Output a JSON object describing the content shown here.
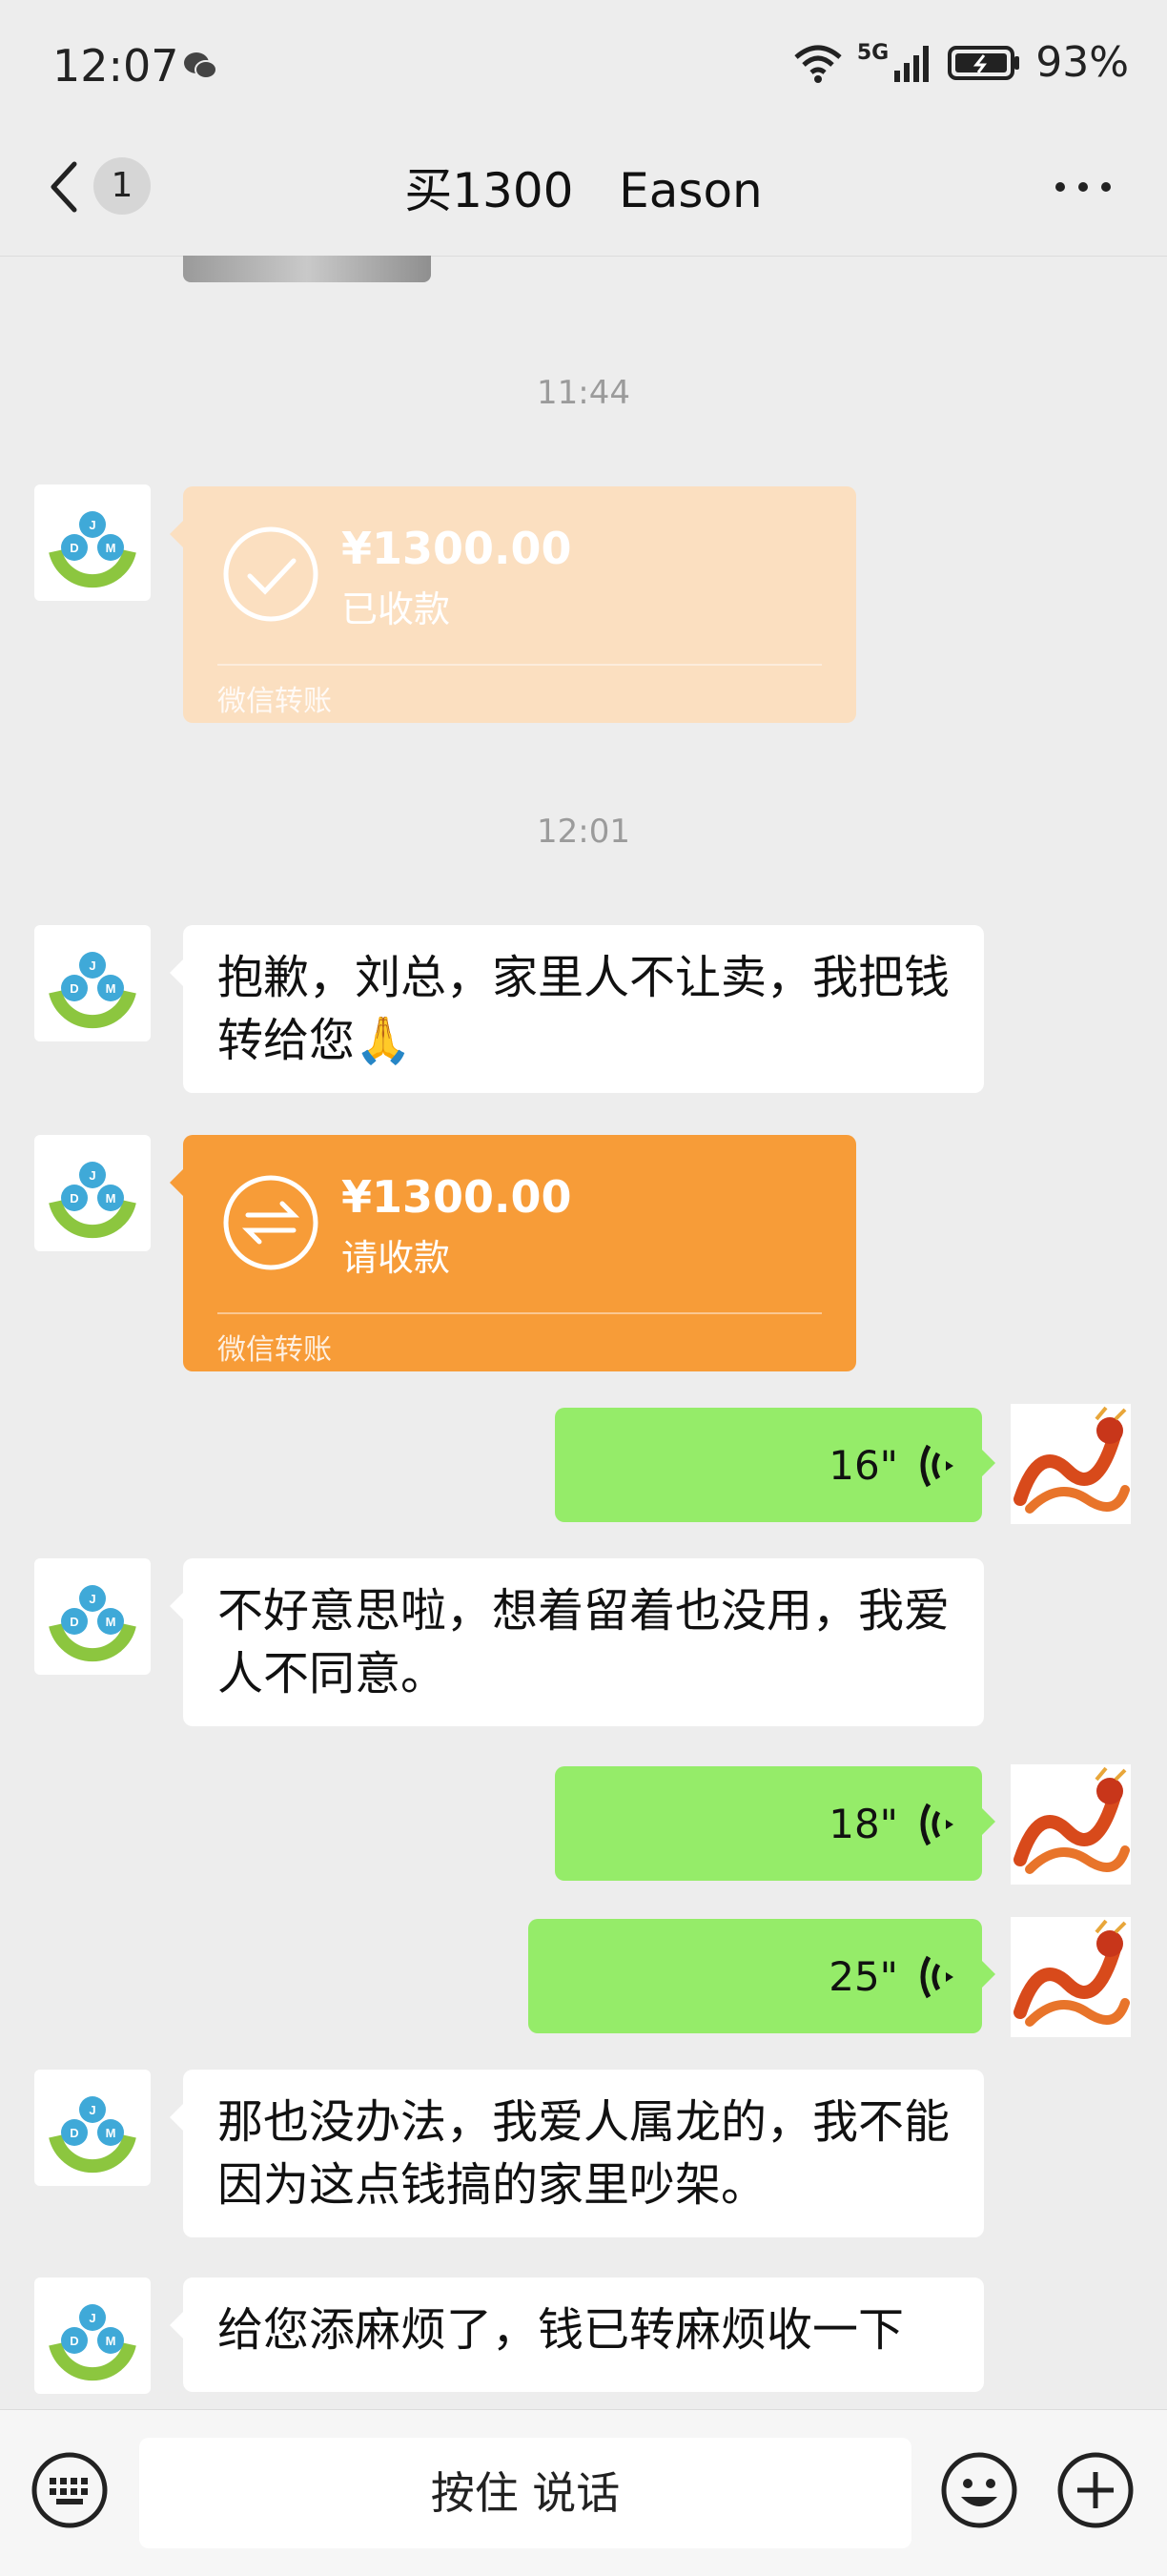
{
  "status_bar": {
    "time": "12:07",
    "network": "5G",
    "battery": "93%"
  },
  "header": {
    "unread_count": "1",
    "title": "买1300   Eason",
    "more_icon": "more-icon"
  },
  "messages": {
    "ts1": "11:44",
    "transfer1": {
      "amount": "¥1300.00",
      "status": "已收款",
      "label": "微信转账"
    },
    "ts2": "12:01",
    "text1": "抱歉，刘总，家里人不让卖，我把钱转给您🙏",
    "transfer2": {
      "amount": "¥1300.00",
      "status": "请收款",
      "label": "微信转账"
    },
    "voice1": "16\"",
    "text2": "不好意思啦，想着留着也没用，我爱人不同意。",
    "voice2": "18\"",
    "voice3": "25\"",
    "text3": "那也没办法，我爱人属龙的，我不能因为这点钱搞的家里吵架。",
    "text4": "给您添麻烦了，钱已转麻烦收一下"
  },
  "input_bar": {
    "talk_label": "按住 说话"
  },
  "colors": {
    "bg": "#ededed",
    "voice_green": "#95ec69",
    "transfer_orange": "#f79c38",
    "transfer_done": "#fbdfc0"
  }
}
